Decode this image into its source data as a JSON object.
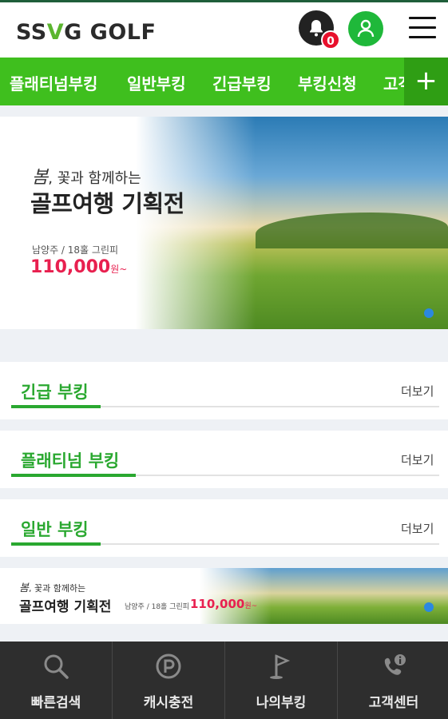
{
  "header": {
    "logo": {
      "part1": "SS",
      "part2": "V",
      "part3": "G GOLF"
    },
    "notification_count": "0"
  },
  "nav": {
    "items": [
      "플래티넘부킹",
      "일반부킹",
      "긴급부킹",
      "부킹신청",
      "고객"
    ],
    "plus": "+"
  },
  "hero": {
    "script": "봄",
    "subtitle": ", 꽃과 함께하는",
    "title": "골프여행 기획전",
    "location": "남양주 / 18홀 그린피",
    "price": "110,000",
    "price_unit": "원~"
  },
  "sections": [
    {
      "title": "긴급 부킹",
      "more": "더보기"
    },
    {
      "title": "플래티넘 부킹",
      "more": "더보기"
    },
    {
      "title": "일반 부킹",
      "more": "더보기"
    }
  ],
  "mini_banner": {
    "script": "봄",
    "subtitle": ", 꽃과 함께하는",
    "title": "골프여행 기획전",
    "location": "남양주 / 18홀 그린피",
    "price": "110,000",
    "price_unit": "원~"
  },
  "bottom_nav": [
    {
      "label": "빠른검색",
      "icon": "search-icon"
    },
    {
      "label": "캐시충전",
      "icon": "point-coin-icon"
    },
    {
      "label": "나의부킹",
      "icon": "golf-flag-icon"
    },
    {
      "label": "고객센터",
      "icon": "phone-info-icon"
    }
  ],
  "colors": {
    "brand_green": "#3fbf1e",
    "accent_green": "#2aa830",
    "price_pink": "#e8204f",
    "badge_red": "#e8102c",
    "bottom_bar": "#2e2e2e"
  }
}
